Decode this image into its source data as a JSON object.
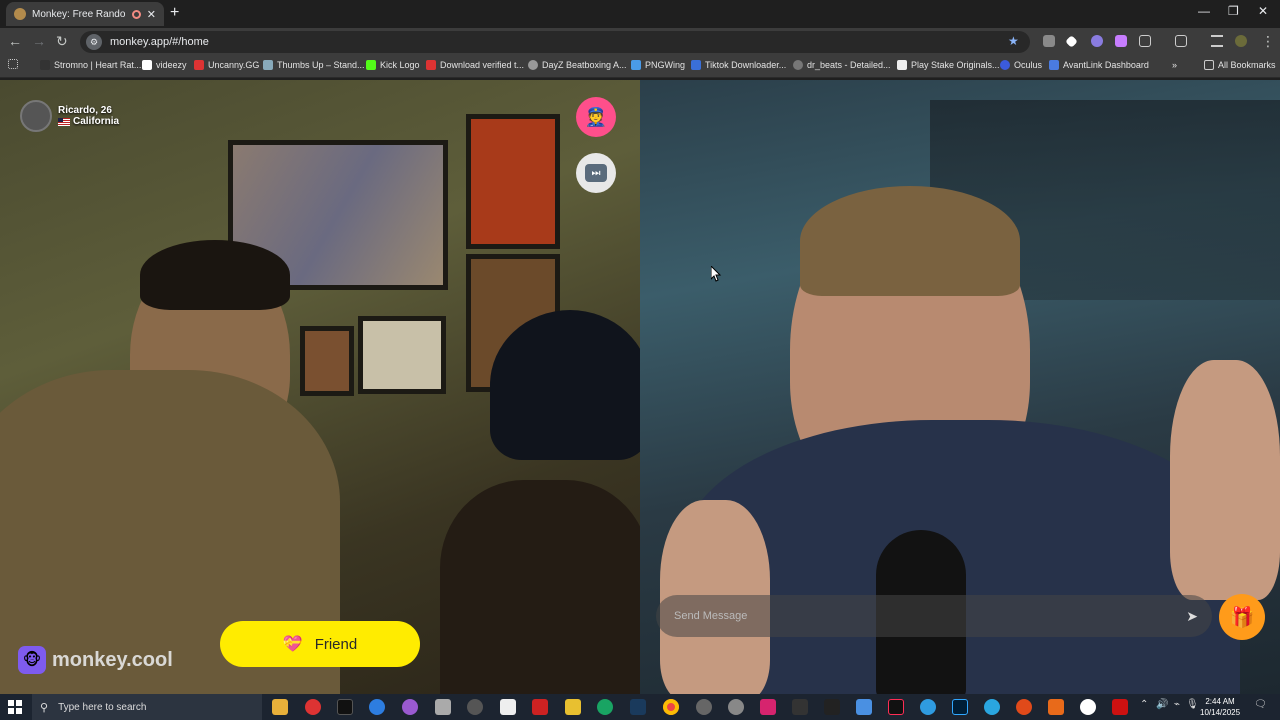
{
  "browser": {
    "tab_title": "Monkey: Free Random Vide",
    "url": "monkey.app/#/home",
    "bookmarks": [
      "Stromno | Heart Rat...",
      "videezy",
      "Uncanny.GG",
      "Thumbs Up – Stand...",
      "Kick Logo",
      "Download verified t...",
      "DayZ Beatboxing A...",
      "PNGWing",
      "Tiktok Downloader...",
      "dr_beats - Detailed...",
      "Play Stake Originals...",
      "Oculus",
      "AvantLink Dashboard"
    ],
    "all_bookmarks": "All Bookmarks"
  },
  "call": {
    "peer_name": "Ricardo, 26",
    "peer_location": "California",
    "friend_label": "Friend",
    "brand": "monkey.cool",
    "message_placeholder": "Send Message"
  },
  "taskbar": {
    "search_placeholder": "Type here to search",
    "time": "2:44 AM",
    "date": "10/14/2025"
  },
  "colors": {
    "friend_button": "#ffec00",
    "report_button": "#ff4f8b",
    "gift_button": "#ff9b1a",
    "brand_purple": "#7e5bef"
  }
}
